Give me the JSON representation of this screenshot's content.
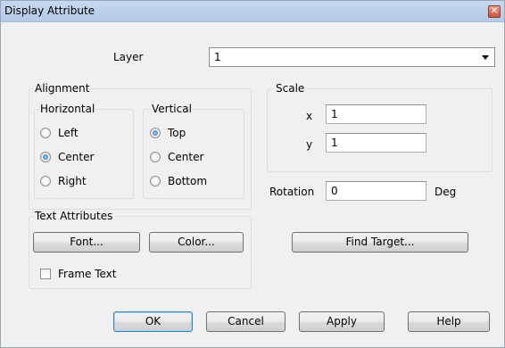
{
  "window": {
    "title": "Display Attribute",
    "close_glyph": "✕"
  },
  "layer": {
    "label": "Layer",
    "value": "1"
  },
  "alignment": {
    "title": "Alignment",
    "horizontal": {
      "title": "Horizontal",
      "options": [
        "Left",
        "Center",
        "Right"
      ],
      "selected": "Center"
    },
    "vertical": {
      "title": "Vertical",
      "options": [
        "Top",
        "Center",
        "Bottom"
      ],
      "selected": "Top"
    }
  },
  "text_attributes": {
    "title": "Text Attributes",
    "font_button": "Font...",
    "color_button": "Color...",
    "frame_text_label": "Frame Text",
    "frame_text_checked": false
  },
  "scale": {
    "title": "Scale",
    "x_label": "x",
    "x_value": "1",
    "y_label": "y",
    "y_value": "1"
  },
  "rotation": {
    "label": "Rotation",
    "value": "0",
    "unit": "Deg"
  },
  "find_target_button": "Find Target...",
  "buttons": {
    "ok": "OK",
    "cancel": "Cancel",
    "apply": "Apply",
    "help": "Help"
  }
}
